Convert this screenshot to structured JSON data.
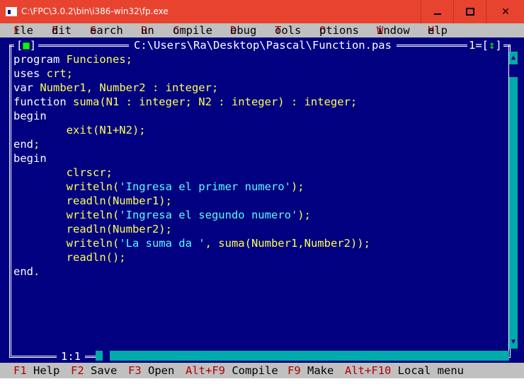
{
  "window": {
    "title": "C:\\FPC\\3.0.2\\bin\\i386-win32\\fp.exe",
    "controls": {
      "minimize": "minimize",
      "maximize": "maximize",
      "close": "close"
    }
  },
  "menu": [
    {
      "hot": "F",
      "rest": "ile"
    },
    {
      "hot": "E",
      "rest": "dit"
    },
    {
      "hot": "S",
      "rest": "earch"
    },
    {
      "hot": "R",
      "rest": "un"
    },
    {
      "hot": "C",
      "rest": "ompile"
    },
    {
      "hot": "D",
      "rest": "ebug"
    },
    {
      "hot": "T",
      "rest": "ools"
    },
    {
      "hot": "O",
      "rest": "ptions"
    },
    {
      "hot": "W",
      "rest": "indow"
    },
    {
      "hot": "H",
      "rest": "elp"
    }
  ],
  "editor": {
    "close_box": "[",
    "close_box_mark": "■",
    "close_box_end": "]",
    "file_path": "C:\\Users\\Ra\\Desktop\\Pascal\\Function.pas",
    "window_number": "1=[",
    "zoom_mark": "↕",
    "window_number_end": "]",
    "cursor_position": "1:1",
    "code_lines": [
      {
        "kw": "program",
        "rest": " Funciones;"
      },
      {
        "kw": "uses",
        "rest": " crt;"
      },
      {
        "kw": "var",
        "rest": " Number1, Number2 : integer;"
      },
      {
        "kw": "function",
        "rest": " suma(N1 : integer; N2 : integer) : integer;"
      },
      {
        "kw": "begin",
        "rest": ""
      },
      {
        "kw": "",
        "rest": "        exit(N1+N2);"
      },
      {
        "kw": "end",
        "rest": ";"
      },
      {
        "kw": "begin",
        "rest": ""
      },
      {
        "kw": "",
        "rest": "        clrscr;"
      },
      {
        "kw": "",
        "rest": "        writeln(",
        "str": "'Ingresa el primer numero'",
        "tail": ");"
      },
      {
        "kw": "",
        "rest": "        readln(Number1);"
      },
      {
        "kw": "",
        "rest": "        writeln(",
        "str": "'Ingresa el segundo numero'",
        "tail": ");"
      },
      {
        "kw": "",
        "rest": "        readln(Number2);"
      },
      {
        "kw": "",
        "rest": "        writeln(",
        "str": "'La suma da '",
        "tail": ", suma(Number1,Number2));"
      },
      {
        "kw": "",
        "rest": "        readln();"
      },
      {
        "kw": "end",
        "rest": "."
      }
    ]
  },
  "status_bar": [
    {
      "key": "F1",
      "label": " Help"
    },
    {
      "key": "F2",
      "label": " Save"
    },
    {
      "key": "F3",
      "label": " Open"
    },
    {
      "key": "Alt+F9",
      "label": " Compile"
    },
    {
      "key": "F9",
      "label": " Make"
    },
    {
      "key": "Alt+F10",
      "label": " Local menu"
    }
  ],
  "colors": {
    "title_bar": "#e8432f",
    "editor_bg": "#000080",
    "code_text": "#ffff55",
    "keyword": "#ffffff",
    "string": "#55ffff",
    "menu_bg": "#c0c0c0",
    "hotkey": "#b40000",
    "scrollbar": "#00aaaa"
  }
}
